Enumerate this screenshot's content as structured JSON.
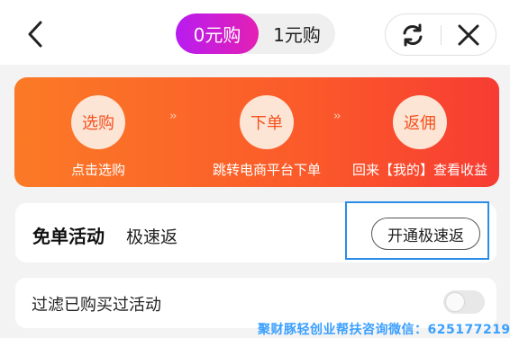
{
  "header": {
    "tabs": [
      {
        "label": "0元购",
        "active": true
      },
      {
        "label": "1元购",
        "active": false
      }
    ],
    "icons": {
      "back": "chevron-left-icon",
      "refresh": "refresh-icon",
      "close": "close-icon"
    }
  },
  "banner": {
    "steps": [
      {
        "title": "选购",
        "caption": "点击选购"
      },
      {
        "title": "下单",
        "caption": "跳转电商平台下单"
      },
      {
        "title": "返佣",
        "caption": "回来【我的】查看收益"
      }
    ],
    "arrow": "››",
    "colors": {
      "from": "#fb7a26",
      "to": "#f73c33"
    }
  },
  "activity": {
    "title": "免单活动",
    "subtitle": "极速返",
    "button_label": "开通极速返"
  },
  "filter": {
    "label": "过滤已购买过活动",
    "enabled": false
  },
  "watermark": "聚财豚轻创业帮扶咨询微信：625177219",
  "colors": {
    "accent": "#c41ee8",
    "highlight": "#2a8ee8"
  }
}
